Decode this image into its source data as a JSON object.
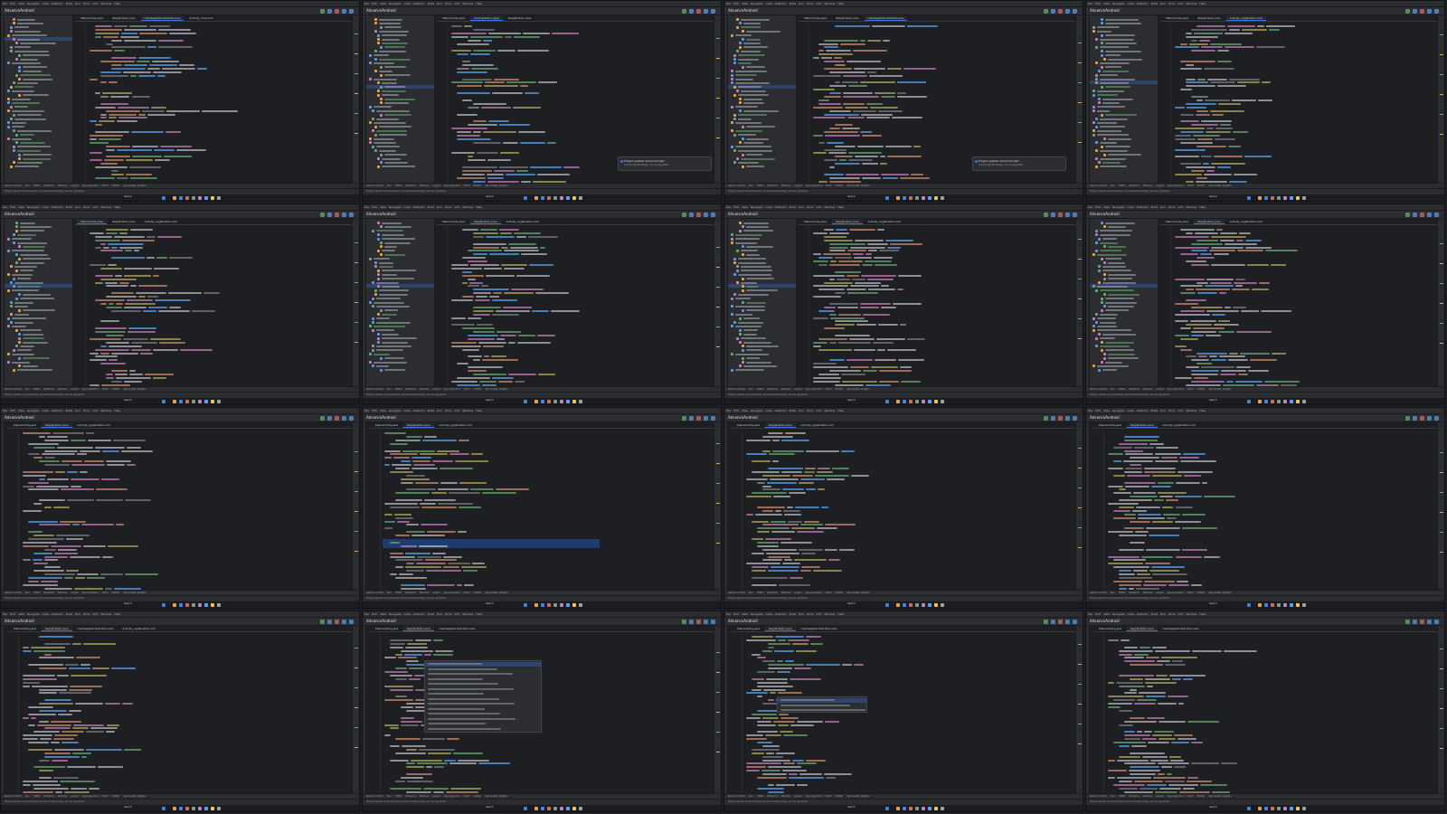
{
  "app": {
    "menu": [
      "File",
      "Edit",
      "View",
      "Navigate",
      "Code",
      "Refactor",
      "Build",
      "Run",
      "Tools",
      "VCS",
      "Window",
      "Help"
    ],
    "project_title": "AdvanceAndroid",
    "taskbar_search": "Search"
  },
  "colors": {
    "ide_bg": "#1e1f22",
    "panel_bg": "#2b2d30",
    "accent": "#3574f0",
    "keyword": "#cf8e6d",
    "string": "#6aab73",
    "function": "#56a8f5",
    "comment": "#7a7e85",
    "annotation": "#b3ae60",
    "field": "#c77dbb",
    "plain": "#bcbec4"
  },
  "bottom_tools": [
    "Version Control",
    "Run",
    "TODO",
    "Problems",
    "Terminal",
    "Logcat",
    "App Inspection",
    "Build",
    "Profiler",
    "App Quality Insights"
  ],
  "status_message": "Project update recommended: Android Gradle Plugin can be upgraded",
  "notification": {
    "title": "Project update recommended",
    "body": "Android Gradle Plugin can be upgraded"
  },
  "screens": [
    {
      "tabs": [
        "MainActivity.java",
        "Registration.java",
        "UserRegisterInterface.java",
        "activity_main.xml"
      ],
      "active_tab": 2,
      "selected_file_row": 5,
      "popup": false,
      "highlight": false,
      "notification": false
    },
    {
      "tabs": [
        "MainActivity.java",
        "build.gradle (:app)",
        "Registration.java"
      ],
      "active_tab": 1,
      "selected_file_row": 17,
      "popup": false,
      "highlight": false,
      "notification": true
    },
    {
      "tabs": [
        "MainActivity.java",
        "Registration.java",
        "UserRegisterInterface.java"
      ],
      "active_tab": 2,
      "selected_file_row": 17,
      "popup": false,
      "highlight": false,
      "notification": true
    },
    {
      "tabs": [
        "MainActivity.java",
        "Registration.java",
        "activity_registration.xml"
      ],
      "active_tab": 2,
      "selected_file_row": 16,
      "popup": false,
      "highlight": false,
      "notification": false
    },
    {
      "tabs": [
        "MainActivity.java",
        "Registration.java",
        "activity_registration.xml"
      ],
      "active_tab": 0,
      "selected_file_row": 16,
      "popup": false,
      "highlight": false,
      "notification": false
    },
    {
      "tabs": [
        "MainActivity.java",
        "Registration.java",
        "activity_registration.xml"
      ],
      "active_tab": 1,
      "selected_file_row": 16,
      "popup": false,
      "highlight": false,
      "notification": false
    },
    {
      "tabs": [
        "MainActivity.java",
        "Registration.java",
        "activity_registration.xml"
      ],
      "active_tab": 1,
      "selected_file_row": 16,
      "popup": false,
      "highlight": false,
      "notification": false
    },
    {
      "tabs": [
        "MainActivity.java",
        "Registration.java",
        "activity_registration.xml"
      ],
      "active_tab": 1,
      "selected_file_row": 16,
      "popup": false,
      "highlight": false,
      "notification": false
    },
    {
      "tabs": [
        "MainActivity.java",
        "Registration.java",
        "activity_registration.xml"
      ],
      "active_tab": 1,
      "selected_file_row": -1,
      "popup": false,
      "highlight": false,
      "notification": false
    },
    {
      "tabs": [
        "MainActivity.java",
        "Registration.java",
        "activity_registration.xml"
      ],
      "active_tab": 1,
      "selected_file_row": -1,
      "popup": false,
      "highlight": true,
      "notification": false
    },
    {
      "tabs": [
        "MainActivity.java",
        "Registration.java",
        "activity_registration.xml"
      ],
      "active_tab": 1,
      "selected_file_row": -1,
      "popup": false,
      "highlight": false,
      "notification": false
    },
    {
      "tabs": [
        "MainActivity.java",
        "Registration.java",
        "activity_registration.xml"
      ],
      "active_tab": 1,
      "selected_file_row": -1,
      "popup": false,
      "highlight": false,
      "notification": false
    },
    {
      "tabs": [
        "MainActivity.java",
        "Registration.java",
        "UserRegisterInterface.java",
        "activity_registration.xml"
      ],
      "active_tab": 1,
      "selected_file_row": -1,
      "popup": false,
      "highlight": false,
      "notification": false
    },
    {
      "tabs": [
        "MainActivity.java",
        "Registration.java",
        "UserRegisterInterface.java"
      ],
      "active_tab": 1,
      "selected_file_row": -1,
      "popup": true,
      "highlight": false,
      "notification": false
    },
    {
      "tabs": [
        "MainActivity.java",
        "Registration.java",
        "UserRegisterInterface.java"
      ],
      "active_tab": 1,
      "selected_file_row": -1,
      "popup": true,
      "highlight": false,
      "notification": false
    },
    {
      "tabs": [
        "MainActivity.java",
        "Registration.java",
        "UserRegisterInterface.java"
      ],
      "active_tab": 1,
      "selected_file_row": -1,
      "popup": false,
      "highlight": false,
      "notification": false
    }
  ]
}
